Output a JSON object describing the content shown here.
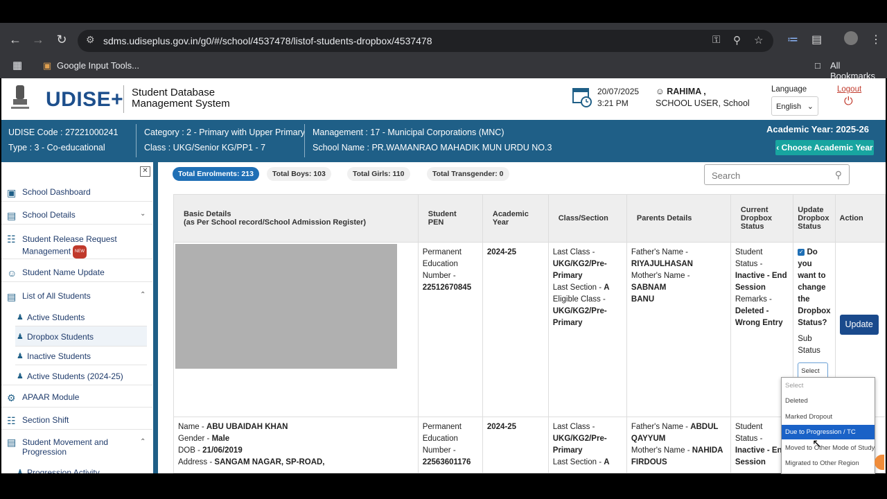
{
  "browser": {
    "url": "sdms.udiseplus.gov.in/g0/#/school/4537478/listof-students-dropbox/4537478",
    "bookmark_google": "Google Input Tools...",
    "bookmark_all": "All Bookmarks"
  },
  "header": {
    "logo": "UDISE+",
    "title_line1": "Student Database",
    "title_line2": "Management System",
    "date": "20/07/2025",
    "time": "3:21 PM",
    "user_name": "RAHIMA ,",
    "user_role": "SCHOOL USER,   School",
    "language_label": "Language",
    "language_value": "English",
    "logout": "Logout"
  },
  "school": {
    "udise_code": "UDISE Code : 27221000241",
    "type": "Type : 3 - Co-educational",
    "category": "Category : 2 - Primary with Upper Primary",
    "class": "Class : UKG/Senior KG/PP1 - 7",
    "management": "Management : 17 - Municipal Corporations (MNC)",
    "school_name": "School Name : PR.WAMANRAO MAHADIK MUN URDU NO.3",
    "academic_year": "Academic Year: 2025-26",
    "choose_year": "Choose Academic Year"
  },
  "sidebar": {
    "items": [
      {
        "label": "School Dashboard"
      },
      {
        "label": "School Details"
      },
      {
        "label": "Student Release Request",
        "label2": "Management",
        "badge": "NEW"
      },
      {
        "label": "Student Name Update"
      },
      {
        "label": "List of All Students"
      },
      {
        "label": "APAAR Module"
      },
      {
        "label": "Section Shift"
      },
      {
        "label": "Student Movement and",
        "label2": "Progression"
      },
      {
        "label": "Progression Activity"
      }
    ],
    "sub_items": [
      {
        "label": "Active Students"
      },
      {
        "label": "Dropbox Students"
      },
      {
        "label": "Inactive Students"
      },
      {
        "label": "Active Students (2024-25)"
      }
    ]
  },
  "stats": {
    "total_enrolments": "Total Enrolments: 213",
    "total_boys": "Total Boys: 103",
    "total_girls": "Total Girls: 110",
    "total_transgender": "Total Transgender: 0"
  },
  "search": {
    "placeholder": "Search"
  },
  "table": {
    "headers": {
      "basic": "Basic Details",
      "basic2": "(as Per School record/School Admission Register)",
      "pen": "Student",
      "pen2": "PEN",
      "year": "Academic",
      "year2": "Year",
      "class": "Class/Section",
      "parents": "Parents Details",
      "current": "Current",
      "current2": "Dropbox",
      "current3": "Status",
      "update": "Update",
      "update2": "Dropbox",
      "update3": "Status",
      "action": "Action"
    },
    "row1": {
      "pen_label1": "Permanent",
      "pen_label2": "Education",
      "pen_label3": "Number -",
      "pen": "22512670845",
      "year": "2024-25",
      "last_class_label": "Last Class -",
      "last_class1": "UKG/KG2/Pre-",
      "last_class2": "Primary",
      "last_section_label": "Last Section -",
      "last_section": "A",
      "eligible_label": "Eligible Class -",
      "eligible1": "UKG/KG2/Pre-",
      "eligible2": "Primary",
      "father_label": "Father's Name -",
      "father": "RIYAJULHASAN",
      "mother_label": "Mother's Name -",
      "mother1": "SABNAM",
      "mother2": "BANU",
      "status1": "Student",
      "status2": "Status -",
      "status3": "Inactive - End",
      "status4": "Session",
      "remarks_label": "Remarks -",
      "remarks1": "Deleted -",
      "remarks2": "Wrong Entry",
      "q1": "Do",
      "q2": "you",
      "q3": "want to",
      "q4": "change",
      "q5": "the",
      "q6": "Dropbox",
      "q7": "Status?",
      "sub_status1": "Sub",
      "sub_status2": "Status",
      "select": "Select",
      "update_btn": "Update"
    },
    "row2": {
      "name_label": "Name -",
      "name": "ABU UBAIDAH KHAN",
      "gender_label": "Gender -",
      "gender": "Male",
      "dob_label": "DOB -",
      "dob": "21/06/2019",
      "address_label": "Address -",
      "address": "SANGAM NAGAR, SP-ROAD,",
      "pen_label1": "Permanent",
      "pen_label2": "Education",
      "pen_label3": "Number -",
      "pen": "22563601176",
      "year": "2024-25",
      "last_class_label": "Last Class -",
      "last_class1": "UKG/KG2/Pre-",
      "last_class2": "Primary",
      "last_section_label": "Last Section -",
      "last_section": "A",
      "father_label": "Father's Name -",
      "father1": "ABDUL",
      "father2": "QAYYUM",
      "mother_label": "Mother's Name -",
      "mother1": "NAHIDA",
      "mother2": "FIRDOUS",
      "status1": "Student",
      "status2": "Status -",
      "status3": "Inactive - End",
      "status4": "Session"
    }
  },
  "dropdown": {
    "options": [
      "Select",
      "Deleted",
      "Marked Dropout",
      "Due to Progression / TC",
      "Moved to Other Mode of Study",
      "Migrated to Other Region"
    ]
  }
}
